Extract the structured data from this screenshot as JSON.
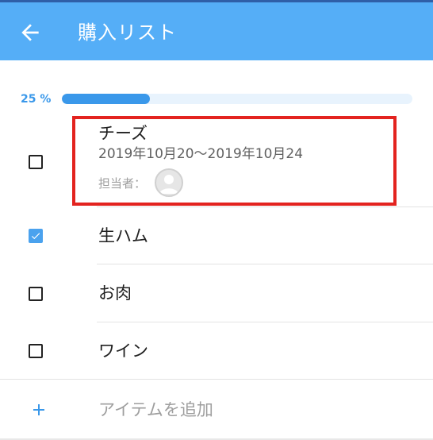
{
  "appbar": {
    "title": "購入リスト",
    "back_icon": "arrow-left-icon",
    "background": "#55aef7"
  },
  "progress": {
    "label": "25 %",
    "value": 0.25,
    "color": "#3a98ea"
  },
  "items": [
    {
      "title": "チーズ",
      "date_range": "2019年10月20〜2019年10月24",
      "assignee_label": "担当者：",
      "assignee_icon": "avatar-placeholder-icon",
      "checked": false
    },
    {
      "title": "生ハム",
      "checked": true
    },
    {
      "title": "お肉",
      "checked": false
    },
    {
      "title": "ワイン",
      "checked": false
    }
  ],
  "add_item": {
    "label": "アイテムを追加",
    "icon": "plus-icon"
  },
  "highlight_color": "#e3231f"
}
